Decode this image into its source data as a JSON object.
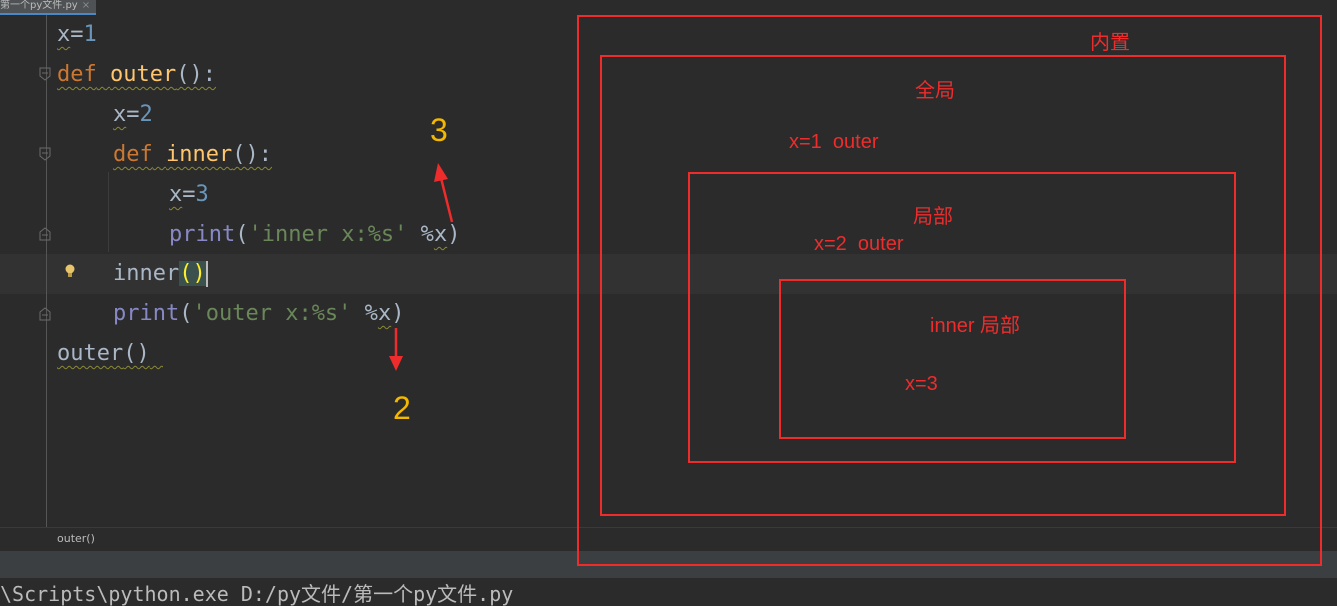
{
  "tab": {
    "title": "第一个py文件.py",
    "close": "×"
  },
  "code": {
    "l1": {
      "var": "x",
      "eq": "=",
      "val": "1"
    },
    "l2": {
      "kw": "def",
      "name": "outer",
      "rest": "():"
    },
    "l3": {
      "var": "x",
      "eq": "=",
      "val": "2"
    },
    "l4": {
      "kw": "def",
      "name": "inner",
      "rest": "():"
    },
    "l5": {
      "var": "x",
      "eq": "=",
      "val": "3"
    },
    "l6": {
      "fn": "print",
      "open": "(",
      "str": "'inner x:%s'",
      "op": " %",
      "var": "x",
      "close": ")"
    },
    "l7": {
      "name": "inner",
      "parens": "()"
    },
    "l8": {
      "fn": "print",
      "open": "(",
      "str": "'outer x:%s'",
      "op": " %",
      "var": "x",
      "close": ")"
    },
    "l9": {
      "name": "outer",
      "parens": "()"
    }
  },
  "breadcrumb": "outer()",
  "console": "\\Scripts\\python.exe D:/py文件/第一个py文件.py",
  "annotations": {
    "num3": "3",
    "num2": "2",
    "builtin_label": "内置",
    "global_label": "全局",
    "global_scope": "x=1  outer",
    "local_label": "局部",
    "local_scope": "x=2  outer",
    "inner_label": "inner 局部",
    "inner_scope": "x=3"
  },
  "colors": {
    "annotation_red": "#ee2c2c",
    "annotation_yellow": "#f5b800",
    "keyword": "#cc7832",
    "number": "#6897bb",
    "string": "#6a8759"
  }
}
